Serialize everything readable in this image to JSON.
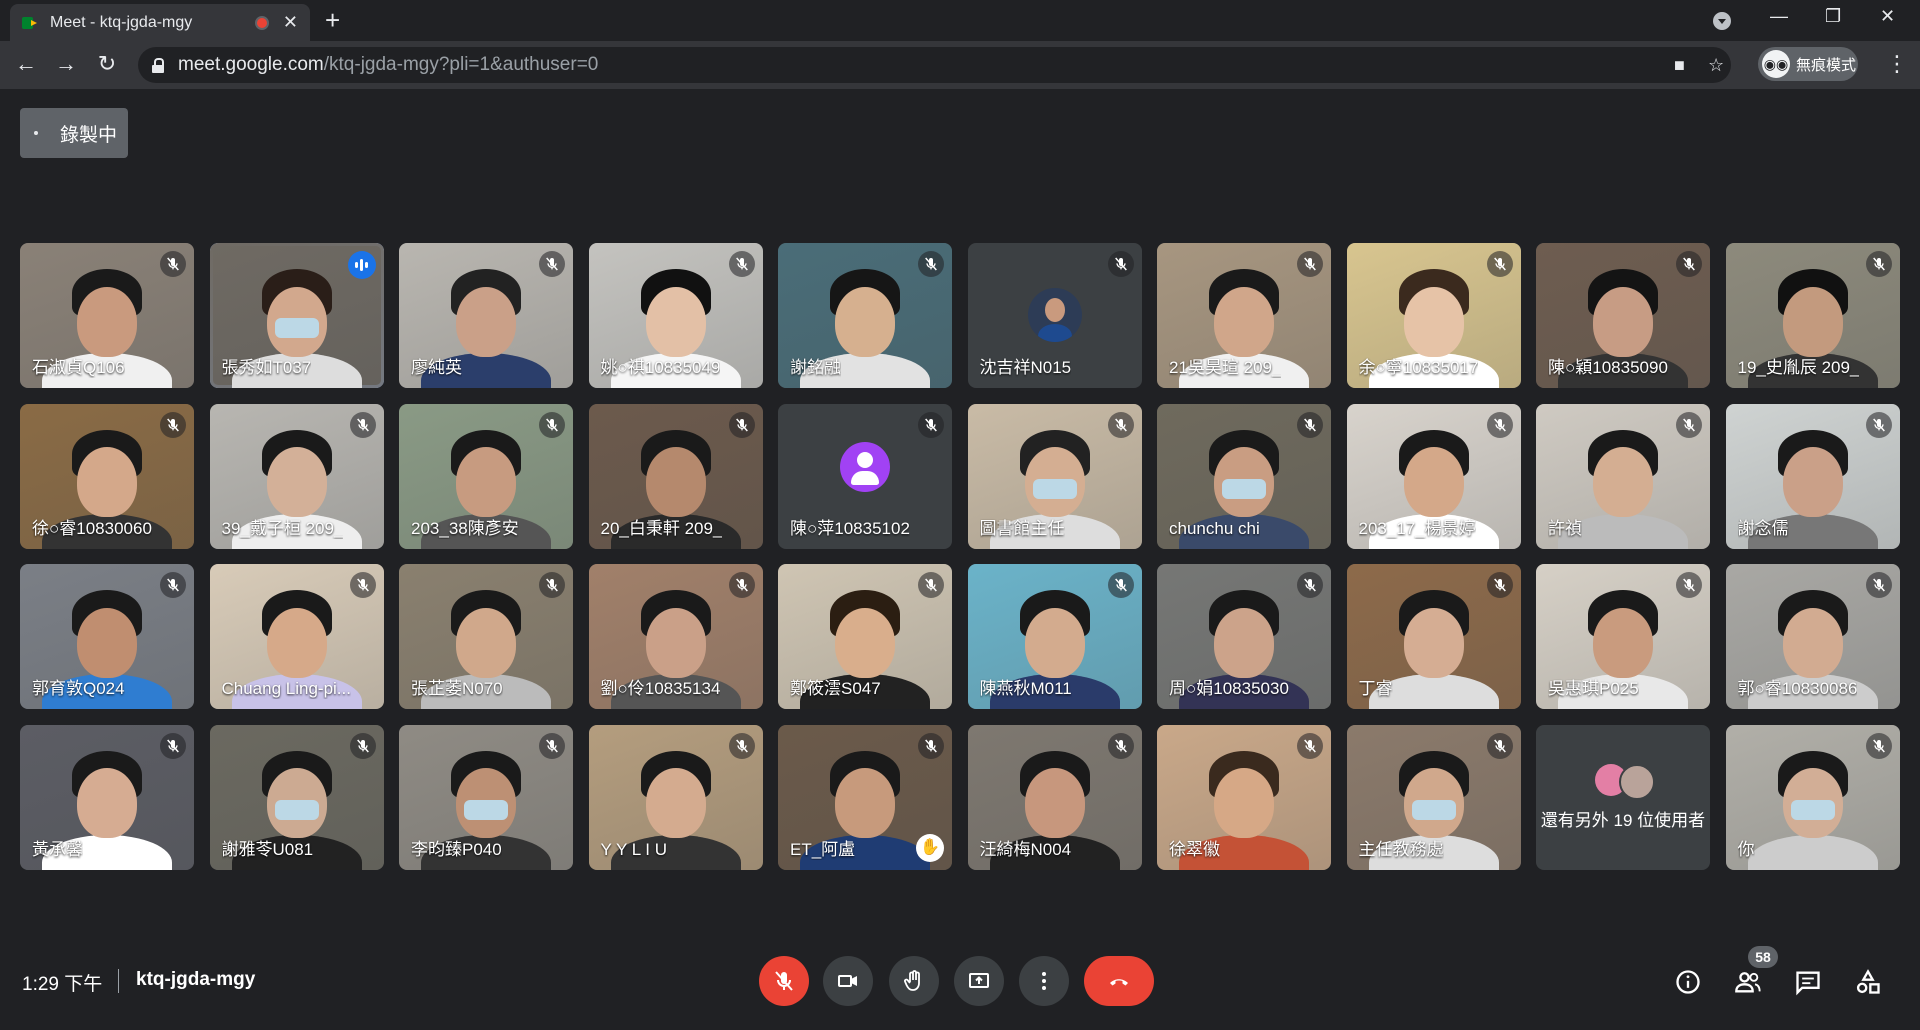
{
  "browser": {
    "tab_title": "Meet - ktq-jgda-mgy",
    "url_host": "meet.google.com",
    "url_path": "/ktq-jgda-mgy?pli=1&authuser=0",
    "incognito_label": "無痕模式",
    "incognito_avatar": "◉◉"
  },
  "recording_label": "錄製中",
  "participants": [
    {
      "name": "石淑貞Q106",
      "bg": "#8a8177",
      "skin": "#c99a7e",
      "hair": "#1a1a1a",
      "shirt": "#f0f0f0",
      "type": "video",
      "mic": "muted"
    },
    {
      "name": "張秀如T037",
      "bg": "#6f6a63",
      "skin": "#d2a88d",
      "hair": "#2a1e18",
      "shirt": "#ddd",
      "type": "video",
      "mic": "speaking",
      "mask": true
    },
    {
      "name": "廖純英",
      "bg": "#b9b6b0",
      "skin": "#caa088",
      "hair": "#222",
      "shirt": "#2b3e6b",
      "type": "video",
      "mic": "muted"
    },
    {
      "name": "姚○祺10835049",
      "bg": "#c4c3bf",
      "skin": "#e3c0a6",
      "hair": "#111",
      "shirt": "#f5f5f5",
      "type": "video",
      "mic": "muted"
    },
    {
      "name": "謝銘融",
      "bg": "#4a6d78",
      "skin": "#d6b08f",
      "hair": "#161616",
      "shirt": "#e2e2e2",
      "type": "video",
      "mic": "muted"
    },
    {
      "name": "沈吉祥N015",
      "type": "photo",
      "mic": "muted"
    },
    {
      "name": "21吳昊瑄 209_",
      "bg": "#a79680",
      "skin": "#d0a68a",
      "hair": "#1a1a1a",
      "shirt": "#f0f0f0",
      "type": "video",
      "mic": "muted"
    },
    {
      "name": "余○寧10835017",
      "bg": "#d8c58f",
      "skin": "#e6c3a7",
      "hair": "#3b2a1e",
      "shirt": "#fff",
      "type": "video",
      "mic": "muted"
    },
    {
      "name": "陳○穎10835090",
      "bg": "#6e5d50",
      "skin": "#c79c84",
      "hair": "#141414",
      "shirt": "#333",
      "type": "video",
      "mic": "muted"
    },
    {
      "name": "19_史胤辰 209_",
      "bg": "#8d8a7c",
      "skin": "#c39a7e",
      "hair": "#111",
      "shirt": "#333",
      "type": "video",
      "mic": "muted"
    },
    {
      "name": "徐○睿10830060",
      "bg": "#8a6b45",
      "skin": "#d4a88a",
      "hair": "#1a1a1a",
      "shirt": "#333",
      "type": "video",
      "mic": "muted"
    },
    {
      "name": "39_戴子桓 209_",
      "bg": "#b8b6b1",
      "skin": "#d3b098",
      "hair": "#1a1a1a",
      "shirt": "#eee",
      "type": "video",
      "mic": "muted"
    },
    {
      "name": "203_38陳彥安",
      "bg": "#8a9a85",
      "skin": "#c79b80",
      "hair": "#1a1a1a",
      "shirt": "#555",
      "type": "video",
      "mic": "muted"
    },
    {
      "name": "20_白秉軒 209_",
      "bg": "#6c5a4c",
      "skin": "#b5896d",
      "hair": "#1a1a1a",
      "shirt": "#2a2a2a",
      "type": "video",
      "mic": "muted"
    },
    {
      "name": "陳○萍10835102",
      "type": "avatar",
      "mic": "muted"
    },
    {
      "name": "圖書館主任",
      "bg": "#c9bba6",
      "skin": "#d4ae92",
      "hair": "#222",
      "shirt": "#ddd",
      "type": "video",
      "mic": "muted",
      "mask": true
    },
    {
      "name": "chunchu chi",
      "bg": "#6f6a5d",
      "skin": "#c99d82",
      "hair": "#1a1a1a",
      "shirt": "#3a4a6a",
      "type": "video",
      "mic": "muted",
      "mask": true
    },
    {
      "name": "203_17_楊景婷",
      "bg": "#d8d3cc",
      "skin": "#d4a889",
      "hair": "#1a1a1a",
      "shirt": "#fff",
      "type": "video",
      "mic": "muted"
    },
    {
      "name": "許禎",
      "bg": "#cfcac2",
      "skin": "#d4ae92",
      "hair": "#1a1a1a",
      "shirt": "#bbb",
      "type": "video",
      "mic": "muted"
    },
    {
      "name": "謝念儒",
      "bg": "#cfd3d2",
      "skin": "#caa088",
      "hair": "#1a1a1a",
      "shirt": "#777",
      "type": "video",
      "mic": "muted"
    },
    {
      "name": "郭育敦Q024",
      "bg": "#7b7f86",
      "skin": "#c08e70",
      "hair": "#1a1a1a",
      "shirt": "#2f7dd1",
      "type": "video",
      "mic": "muted"
    },
    {
      "name": "Chuang Ling-pi...",
      "bg": "#d8cbb8",
      "skin": "#d6a989",
      "hair": "#1a1a1a",
      "shirt": "#c8c2e8",
      "type": "video",
      "mic": "muted"
    },
    {
      "name": "張芷萎N070",
      "bg": "#8a806f",
      "skin": "#d0a88b",
      "hair": "#1a1a1a",
      "shirt": "#bbb",
      "type": "video",
      "mic": "muted"
    },
    {
      "name": "劉○伶10835134",
      "bg": "#a1806a",
      "skin": "#caa088",
      "hair": "#1a1a1a",
      "shirt": "#555",
      "type": "video",
      "mic": "muted"
    },
    {
      "name": "鄭筱澐S047",
      "bg": "#cfc5b3",
      "skin": "#d9ae8c",
      "hair": "#2b1e12",
      "shirt": "#222",
      "type": "video",
      "mic": "muted"
    },
    {
      "name": "陳燕秋M011",
      "bg": "#6bb3c9",
      "skin": "#d3ab8e",
      "hair": "#1a1a1a",
      "shirt": "#2a3b6a",
      "type": "video",
      "mic": "muted"
    },
    {
      "name": "周○娟10835030",
      "bg": "#767775",
      "skin": "#cca38a",
      "hair": "#1a1a1a",
      "shirt": "#335",
      "type": "video",
      "mic": "muted"
    },
    {
      "name": "丁睿",
      "bg": "#8d6a4a",
      "skin": "#d5ad93",
      "hair": "#1a1a1a",
      "shirt": "#ddd",
      "type": "video",
      "mic": "muted"
    },
    {
      "name": "吳惠琪P025",
      "bg": "#d6d0c6",
      "skin": "#c99b7e",
      "hair": "#1a1a1a",
      "shirt": "#e8e8e8",
      "type": "video",
      "mic": "muted"
    },
    {
      "name": "郭○睿10830086",
      "bg": "#a9a8a4",
      "skin": "#d2ab91",
      "hair": "#1a1a1a",
      "shirt": "#ccc",
      "type": "video",
      "mic": "muted"
    },
    {
      "name": "黃承馨",
      "bg": "#5c5d64",
      "skin": "#d6ac92",
      "hair": "#1a1a1a",
      "shirt": "#fff",
      "type": "video",
      "mic": "muted"
    },
    {
      "name": "謝雅苓U081",
      "bg": "#6b6960",
      "skin": "#ccaa92",
      "hair": "#1a1a1a",
      "shirt": "#222",
      "type": "video",
      "mic": "muted",
      "mask": true
    },
    {
      "name": "李昀臻P040",
      "bg": "#8f8b84",
      "skin": "#bd9074",
      "hair": "#1a1a1a",
      "shirt": "#333",
      "type": "video",
      "mic": "muted",
      "mask": true
    },
    {
      "name": "Y Y L I U",
      "bg": "#b49d7e",
      "skin": "#d4ab8f",
      "hair": "#1a1a1a",
      "shirt": "#333",
      "type": "video",
      "mic": "muted"
    },
    {
      "name": "ET_阿盧",
      "bg": "#6b5a4a",
      "skin": "#c79a7c",
      "hair": "#1a1a1a",
      "shirt": "#1f3c73",
      "type": "video",
      "mic": "muted",
      "hand": true
    },
    {
      "name": "汪綺梅N004",
      "bg": "#7e7870",
      "skin": "#c7977d",
      "hair": "#1a1a1a",
      "shirt": "#222",
      "type": "video",
      "mic": "muted"
    },
    {
      "name": "徐翠徽",
      "bg": "#c9a889",
      "skin": "#d6a886",
      "hair": "#3a2a1e",
      "shirt": "#c45236",
      "type": "video",
      "mic": "muted"
    },
    {
      "name": "主任教務處",
      "bg": "#8b7a6b",
      "skin": "#d0a88c",
      "hair": "#1a1a1a",
      "shirt": "#ddd",
      "type": "video",
      "mic": "muted",
      "mask": true
    },
    {
      "name": "還有另外 19 位使用者",
      "type": "others",
      "mic": "none"
    },
    {
      "name": "你",
      "bg": "#b1afa8",
      "skin": "#d2ae96",
      "hair": "#1a1a1a",
      "shirt": "#ccc",
      "type": "video",
      "mic": "muted",
      "mask": true
    }
  ],
  "footer": {
    "time": "1:29 下午",
    "meeting_code": "ktq-jgda-mgy",
    "people_count": "58"
  }
}
